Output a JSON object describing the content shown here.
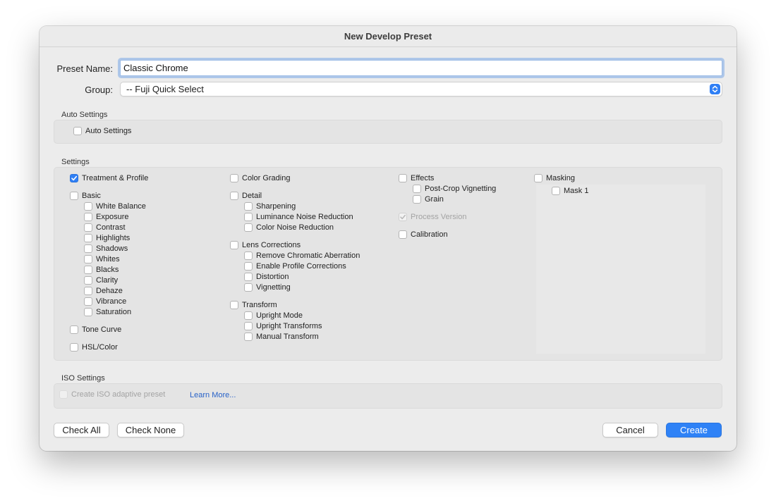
{
  "window": {
    "title": "New Develop Preset"
  },
  "preset_name": {
    "label": "Preset Name:",
    "value": "Classic Chrome"
  },
  "group": {
    "label": "Group:",
    "value": "-- Fuji Quick Select"
  },
  "auto_settings": {
    "title": "Auto Settings",
    "checkbox": {
      "label": "Auto Settings",
      "checked": false
    }
  },
  "settings": {
    "title": "Settings",
    "col1": {
      "treatment": {
        "label": "Treatment & Profile",
        "checked": true
      },
      "basic": {
        "label": "Basic",
        "checked": false
      },
      "basic_items": [
        "White Balance",
        "Exposure",
        "Contrast",
        "Highlights",
        "Shadows",
        "Whites",
        "Blacks",
        "Clarity",
        "Dehaze",
        "Vibrance",
        "Saturation"
      ],
      "tone_curve": {
        "label": "Tone Curve",
        "checked": false
      },
      "hsl": {
        "label": "HSL/Color",
        "checked": false
      }
    },
    "col2": {
      "color_grading": {
        "label": "Color Grading",
        "checked": false
      },
      "detail": {
        "label": "Detail",
        "checked": false
      },
      "detail_items": [
        "Sharpening",
        "Luminance Noise Reduction",
        "Color Noise Reduction"
      ],
      "lens": {
        "label": "Lens Corrections",
        "checked": false
      },
      "lens_items": [
        "Remove Chromatic Aberration",
        "Enable Profile Corrections",
        "Distortion",
        "Vignetting"
      ],
      "transform": {
        "label": "Transform",
        "checked": false
      },
      "transform_items": [
        "Upright Mode",
        "Upright Transforms",
        "Manual Transform"
      ]
    },
    "col3": {
      "effects": {
        "label": "Effects",
        "checked": false
      },
      "effects_items": [
        "Post-Crop Vignetting",
        "Grain"
      ],
      "process_version": {
        "label": "Process Version",
        "checked": true,
        "disabled": true
      },
      "calibration": {
        "label": "Calibration",
        "checked": false
      }
    },
    "col4": {
      "masking": {
        "label": "Masking",
        "checked": false
      },
      "masking_items": [
        "Mask 1"
      ]
    }
  },
  "iso_settings": {
    "title": "ISO Settings",
    "checkbox": {
      "label": "Create ISO adaptive preset",
      "checked": false,
      "disabled": true
    },
    "learn_more": "Learn More..."
  },
  "buttons": {
    "check_all": "Check All",
    "check_none": "Check None",
    "cancel": "Cancel",
    "create": "Create"
  },
  "colors": {
    "accent": "#2f7ff5",
    "link": "#2862c8"
  },
  "icons": {
    "check": "checkmark-icon",
    "select": "updown-chevron-icon"
  }
}
